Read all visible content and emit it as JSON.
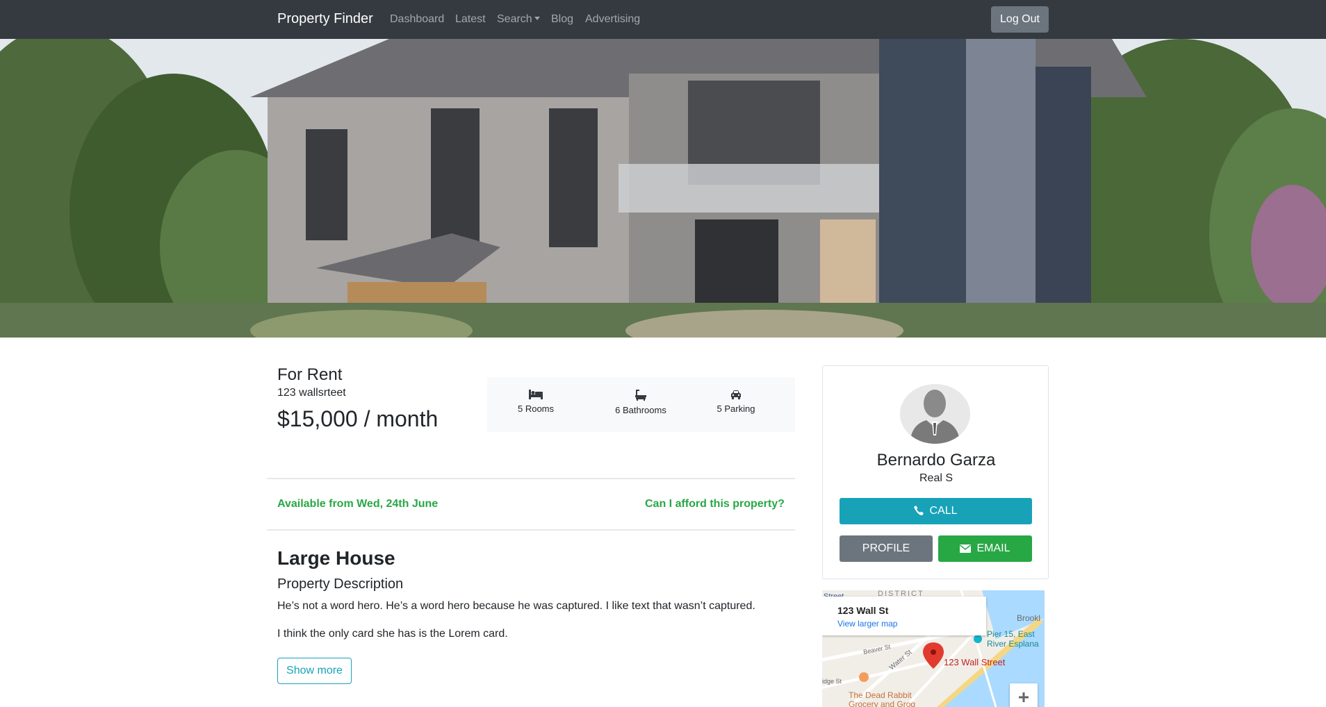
{
  "navbar": {
    "brand": "Property Finder",
    "links": [
      "Dashboard",
      "Latest",
      "Search",
      "Blog",
      "Advertising"
    ],
    "logout": "Log Out"
  },
  "listing": {
    "status": "For Rent",
    "address": "123 wallsrteet",
    "price": "$15,000 / month",
    "features": [
      {
        "icon": "bed-icon",
        "label": "5 Rooms"
      },
      {
        "icon": "bath-icon",
        "label": "6 Bathrooms"
      },
      {
        "icon": "car-icon",
        "label": "5 Parking"
      }
    ],
    "available": "Available from Wed, 24th June",
    "afford": "Can I afford this property?",
    "title": "Large House",
    "subtitle": "Property Description",
    "description": [
      "He’s not a word hero. He’s a word hero because he was captured. I like text that wasn’t captured.",
      "I think the only card she has is the Lorem card."
    ],
    "show_more": "Show more"
  },
  "agent": {
    "name": "Bernardo Garza",
    "role": "Real S",
    "call": "CALL",
    "profile": "PROFILE",
    "email": "EMAIL"
  },
  "map": {
    "info_title": "123 Wall St",
    "info_link": "View larger map",
    "marker_label": "123 Wall Street",
    "labels": {
      "street": "Street",
      "district": "DISTRICT",
      "brookl": "Brookl",
      "pier1": "Pier 15, East",
      "pier2": "River Esplana",
      "beaver": "Beaver St",
      "water": "Water St",
      "idge": "idge St",
      "rabbit1": "The Dead Rabbit",
      "rabbit2": "Grocery and Grog"
    }
  },
  "colors": {
    "navbar": "#343a40",
    "info": "#17a2b8",
    "success": "#28a745",
    "secondary": "#6c757d"
  }
}
